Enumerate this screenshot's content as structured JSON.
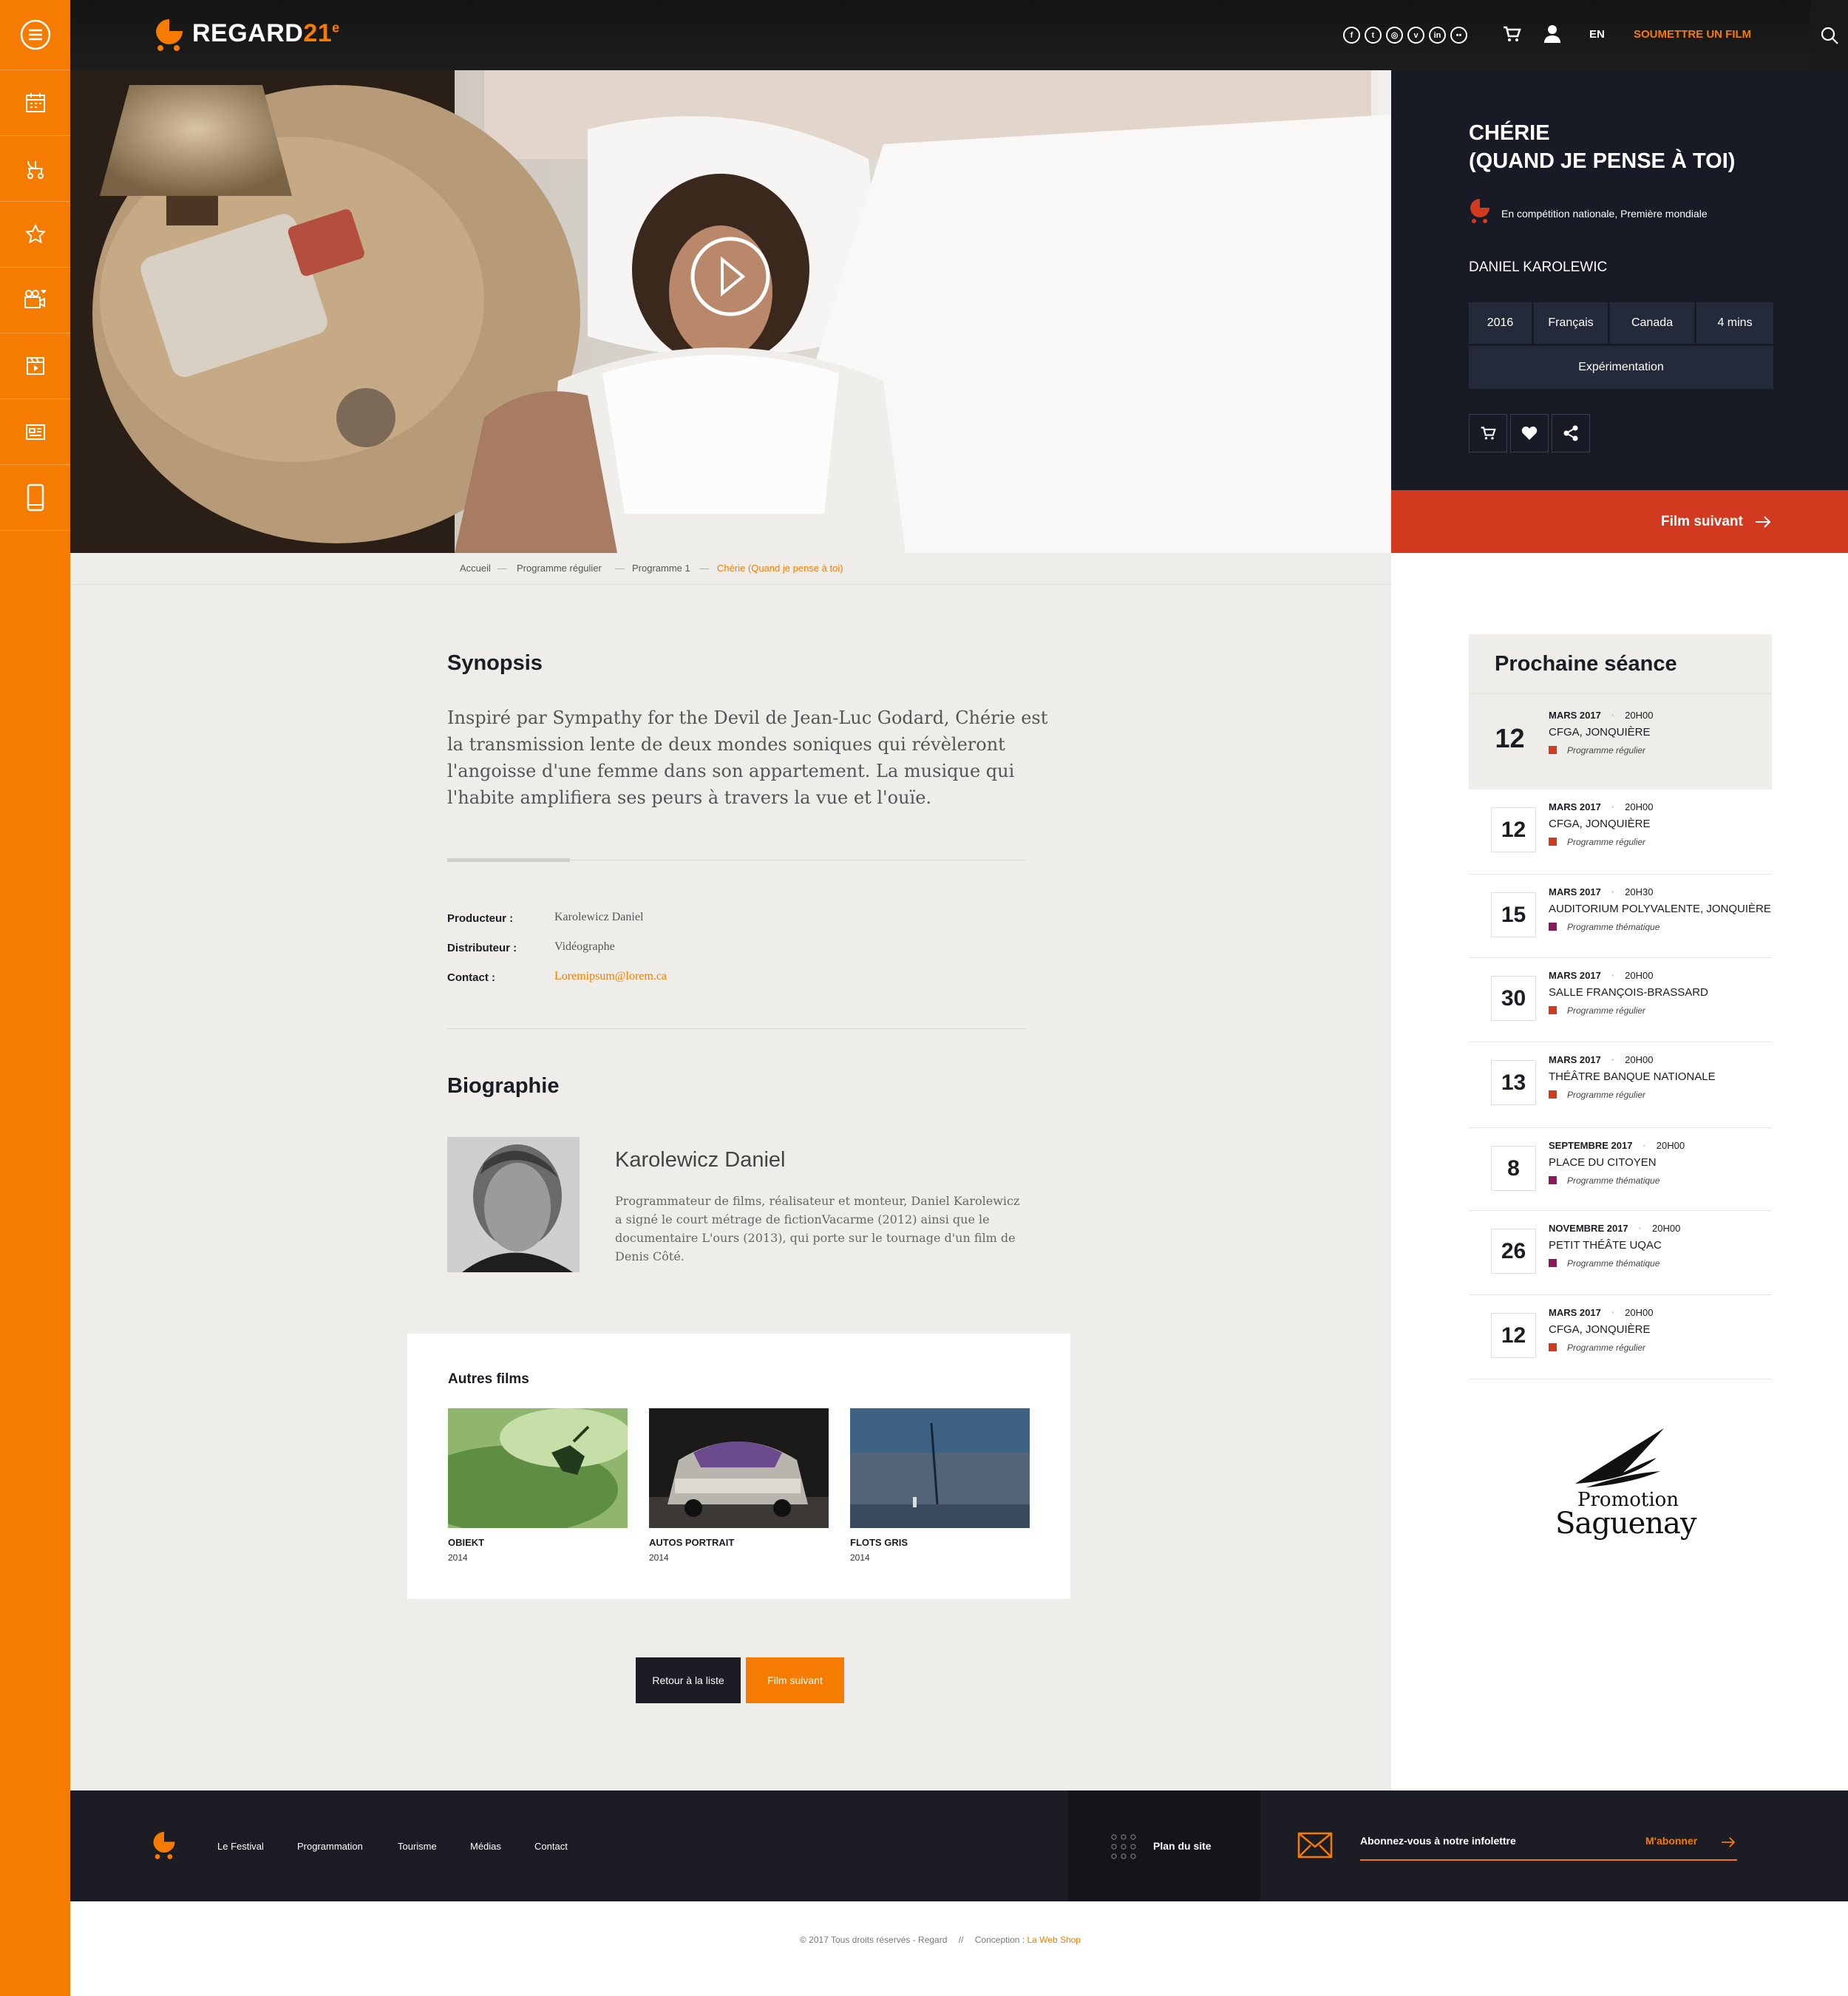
{
  "brand": {
    "name": "REGARD",
    "number": "21",
    "sup": "e"
  },
  "header": {
    "social": [
      "f",
      "t",
      "◎",
      "v",
      "in",
      "••"
    ],
    "lang": "EN",
    "submit": "SOUMETTRE UN FILM"
  },
  "film": {
    "title_line1": "CHÉRIE",
    "title_line2": "(QUAND JE PENSE À TOI)",
    "competition": "En compétition nationale, Première mondiale",
    "director": "DANIEL KAROLEWIC",
    "year": "2016",
    "language": "Français",
    "country": "Canada",
    "duration": "4 mins",
    "genre": "Expérimentation",
    "next_label": "Film suivant"
  },
  "breadcrumb": {
    "items": [
      "Accueil",
      "Programme régulier",
      "Programme 1"
    ],
    "current": "Chérie (Quand je pense à toi)"
  },
  "synopsis": {
    "heading": "Synopsis",
    "text": "Inspiré par Sympathy for the Devil de Jean-Luc Godard, Chérie est la transmission lente de deux mondes soniques qui révèleront l'angoisse d'une femme dans son appartement. La musique qui l'habite amplifiera ses peurs à travers la vue et l'ouïe."
  },
  "credits": {
    "producer_label": "Producteur :",
    "producer": "Karolewicz Daniel",
    "distributor_label": "Distributeur :",
    "distributor": "Vidéographe",
    "contact_label": "Contact :",
    "contact": "Loremipsum@lorem.ca"
  },
  "bio": {
    "heading": "Biographie",
    "name": "Karolewicz Daniel",
    "text": "Programmateur de films, réalisateur et monteur, Daniel Karolewicz a signé le court métrage de fictionVacarme (2012) ainsi que le documentaire L'ours (2013), qui porte sur le tournage d'un film de Denis Côté."
  },
  "autres": {
    "heading": "Autres films",
    "films": [
      {
        "title": "OBIEKT",
        "year": "2014"
      },
      {
        "title": "AUTOS PORTRAIT",
        "year": "2014"
      },
      {
        "title": "FLOTS GRIS",
        "year": "2014"
      }
    ]
  },
  "buttons": {
    "back": "Retour à la liste",
    "next": "Film suivant"
  },
  "seances": {
    "heading": "Prochaine séance",
    "colors": {
      "regulier": "#d13a1f",
      "thematique": "#8a1a5a"
    },
    "items": [
      {
        "day": "12",
        "month": "MARS 2017",
        "time": "20H00",
        "place": "CFGA, JONQUIÈRE",
        "program": "Programme régulier",
        "kind": "regulier"
      },
      {
        "day": "12",
        "month": "MARS 2017",
        "time": "20H00",
        "place": "CFGA, JONQUIÈRE",
        "program": "Programme régulier",
        "kind": "regulier"
      },
      {
        "day": "15",
        "month": "MARS 2017",
        "time": "20H30",
        "place": "AUDITORIUM POLYVALENTE, JONQUIÈRE",
        "program": "Programme thématique",
        "kind": "thematique"
      },
      {
        "day": "30",
        "month": "MARS 2017",
        "time": "20H00",
        "place": "SALLE FRANÇOIS-BRASSARD",
        "program": "Programme régulier",
        "kind": "regulier"
      },
      {
        "day": "13",
        "month": "MARS 2017",
        "time": "20H00",
        "place": "THÉÂTRE BANQUE NATIONALE",
        "program": "Programme régulier",
        "kind": "regulier"
      },
      {
        "day": "8",
        "month": "SEPTEMBRE 2017",
        "time": "20H00",
        "place": "PLACE DU CITOYEN",
        "program": "Programme thématique",
        "kind": "thematique"
      },
      {
        "day": "26",
        "month": "NOVEMBRE 2017",
        "time": "20H00",
        "place": "PETIT THÉÂTE UQAC",
        "program": "Programme thématique",
        "kind": "thematique"
      },
      {
        "day": "12",
        "month": "MARS 2017",
        "time": "20H00",
        "place": "CFGA, JONQUIÈRE",
        "program": "Programme régulier",
        "kind": "regulier"
      }
    ]
  },
  "sponsor": {
    "line1": "Promotion",
    "line2": "Saguenay"
  },
  "footer": {
    "links": [
      "Le Festival",
      "Programmation",
      "Tourisme",
      "Médias",
      "Contact"
    ],
    "sitemap": "Plan du site",
    "newsletter": "Abonnez-vous à notre infolettre",
    "subscribe": "M'abonner",
    "copyright": "© 2017  Tous droits réservés - Regard",
    "separator": "//",
    "design_label": "Conception :",
    "design_by": "La Web Shop"
  },
  "colors": {
    "accent": "#f57c00",
    "dark": "#181b26",
    "red": "#d13a1f"
  }
}
